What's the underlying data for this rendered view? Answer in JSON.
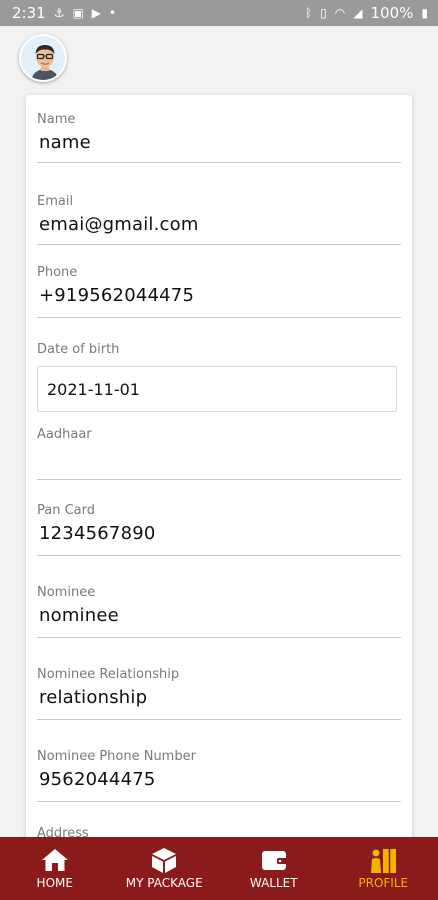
{
  "status_bar": {
    "time": "2:31",
    "battery": "100%"
  },
  "profile": {
    "fields": [
      {
        "label": "Name",
        "value": "name"
      },
      {
        "label": "Email",
        "value": "emai@gmail.com"
      },
      {
        "label": "Phone",
        "value": "+919562044475"
      },
      {
        "label": "Date of birth",
        "value": "2021-11-01"
      },
      {
        "label": "Aadhaar",
        "value": ""
      },
      {
        "label": "Pan Card",
        "value": "1234567890"
      },
      {
        "label": "Nominee",
        "value": "nominee"
      },
      {
        "label": "Nominee Relationship",
        "value": "relationship"
      },
      {
        "label": "Nominee Phone Number",
        "value": "9562044475"
      },
      {
        "label": "Address",
        "value": ""
      }
    ]
  },
  "bottom_nav": {
    "items": [
      {
        "label": "HOME",
        "icon": "home-icon"
      },
      {
        "label": "MY PACKAGE",
        "icon": "package-icon"
      },
      {
        "label": "WALLET",
        "icon": "wallet-icon"
      },
      {
        "label": "PROFILE",
        "icon": "profile-icon"
      }
    ],
    "active": "PROFILE",
    "colors": {
      "background": "#8b1a1a",
      "active": "#f0b400",
      "inactive": "#ffffff"
    }
  }
}
